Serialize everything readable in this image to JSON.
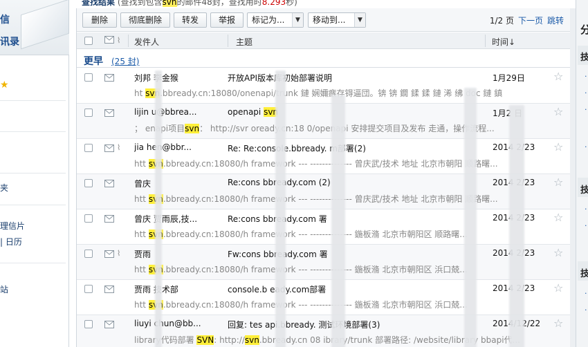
{
  "summary": {
    "title": "查找结果",
    "text_pre": "(查找到包含",
    "keyword": "svn",
    "text_mid": "的邮件48封，查找用时",
    "time": "8.293",
    "text_post": "秒)"
  },
  "sidebar_left": {
    "line1": "信",
    "line2": "讯录",
    "items": [
      "夹",
      "理信片",
      "| 日历",
      "站"
    ]
  },
  "toolbar": {
    "delete_label": "删除",
    "purge_label": "彻底删除",
    "forward_label": "转发",
    "report_label": "举报",
    "mark_label": "标记为...",
    "move_label": "移动到...",
    "page_info": "1/2 页",
    "next_label": "下一页",
    "jump_label": "跳转"
  },
  "columns": {
    "from": "发件人",
    "subject": "主题",
    "time": "时间↓"
  },
  "group": {
    "title": "更早",
    "count": "(25 封)"
  },
  "emails": [
    {
      "from": "刘邦 李金猴",
      "subject": "开放API版本库初始部署说明",
      "date": "1月29日",
      "attach": false,
      "preview": "ht   svn.bbready.cn:18080/onenapi/trunk 鏈   娴嬭瘯存锝逼団。锛   锛   鐗   鍒   鍒   鏈 浠   绋   doc   鏈   鎮"
    },
    {
      "from": "lijin   u@bbrea...",
      "subject": "openapi   svn",
      "date": "1月2 日",
      "attach": false,
      "preview": "；  enapi项目svn：  http://svr  oready.cn:18  0/openapi 安排提交项目及发布  走通，操作流程..."
    },
    {
      "from": "jia    hen@bbr...",
      "subject": "Re: Re:console.bbready.   m部署(2)",
      "date": "2014  2/23",
      "attach": true,
      "preview": "htt    svn.bbready.cn:18080/h   framework ---   -------------- 曾庆武/技术 地址  北京市朝阳   顺路曙..."
    },
    {
      "from": "曾庆",
      "subject": "Re:cons   bbready.com   (2)",
      "date": "2014  2/23",
      "attach": false,
      "preview": "htt    svn.bbready.cn:18080/h   framework ---   -------------- 曾庆武/技术 地址  北京市朝阳   顺路曙..."
    },
    {
      "from": "曾庆   贾雨辰,技...",
      "subject": "Re:cons   bbready.com   署",
      "date": "2014  2/23",
      "attach": false,
      "preview": "htt    svn.bbready.cn:18080/h   framework ---   -------------- 鍦板潃  北京市朝阳区   顺路曙..."
    },
    {
      "from": "贾雨",
      "subject": "Fw:cons   bbready.com   署",
      "date": "2014  2/23",
      "attach": true,
      "preview": "htt    svn.bbready.cn:18080/h   framework ---   -------------- 鍦板潃  北京市朝阳区   浜口兢..."
    },
    {
      "from": "贾雨   技术部",
      "subject": "console.b   eady.com部署",
      "date": "2014  2/23",
      "attach": false,
      "preview": "htt    svn.bbready.cn:18080/h   framework ---   -------------- 鍦板潃  北京市朝阳区   浜口兢..."
    },
    {
      "from": "liuyi   chun@bb...",
      "subject": "回复: tes   api.bbready.   测试环境部署(3)",
      "date": "2014/12/22",
      "attach": false,
      "preview": "library代码部署 SVN: http://svn.bbready.cn   08   ibrary/trunk 部署路径: /website/library bbapi代..."
    }
  ],
  "sidebar_right": {
    "heading": "分",
    "marks": [
      "技",
      "技",
      "技"
    ]
  }
}
